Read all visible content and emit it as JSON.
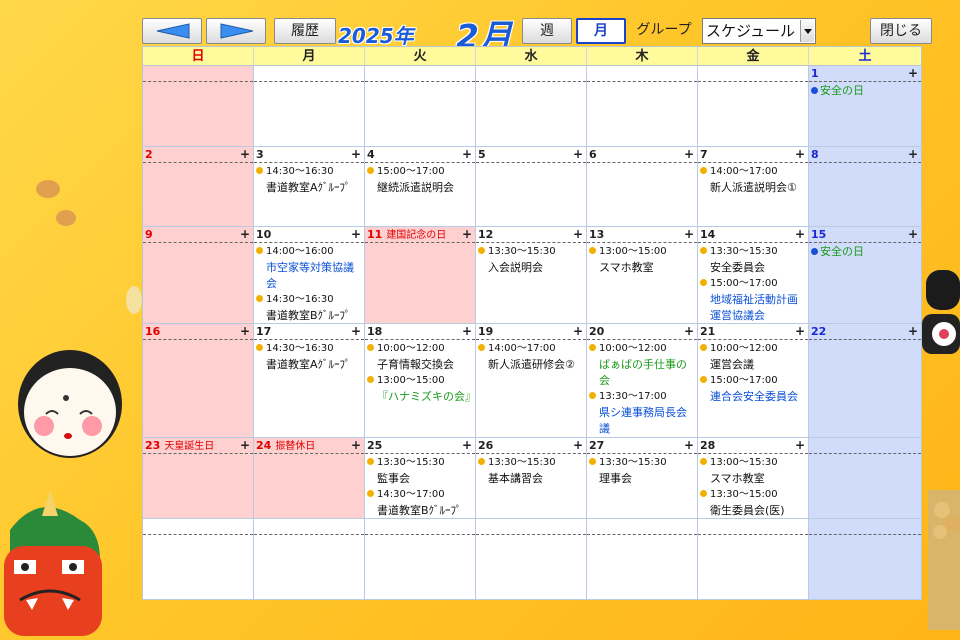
{
  "toolbar": {
    "prev_icon": "left-triangle-arrow",
    "next_icon": "right-triangle-arrow",
    "history_label": "履歴",
    "year": "2025年",
    "month": "2月",
    "week_label": "週",
    "month_label": "月",
    "group_label": "グループ",
    "view_select_value": "スケジュール",
    "close_label": "閉じる"
  },
  "colors": {
    "sunday_text": "#e00000",
    "saturday_text": "#1a2ad0",
    "sunday_bg": "#ffd0d0",
    "saturday_bg": "#d1dcfb",
    "weekday_header_bg": "#fffa9c",
    "event_dot": "#f2b000",
    "note_dot": "#1a4ed6",
    "link_blue": "#0a4fd6",
    "link_green": "#1a9a1a"
  },
  "weekdays": [
    "日",
    "月",
    "火",
    "水",
    "木",
    "金",
    "土"
  ],
  "weeks": [
    [
      {
        "day": "",
        "type": "sun",
        "plus": false,
        "events": []
      },
      {
        "day": "",
        "type": "",
        "plus": false,
        "events": []
      },
      {
        "day": "",
        "type": "",
        "plus": false,
        "events": []
      },
      {
        "day": "",
        "type": "",
        "plus": false,
        "events": []
      },
      {
        "day": "",
        "type": "",
        "plus": false,
        "events": []
      },
      {
        "day": "",
        "type": "",
        "plus": false,
        "events": []
      },
      {
        "day": "1",
        "type": "sat",
        "plus": true,
        "notes": [
          "安全の日"
        ],
        "events": []
      }
    ],
    [
      {
        "day": "2",
        "type": "sun",
        "plus": true,
        "events": []
      },
      {
        "day": "3",
        "type": "",
        "plus": true,
        "events": [
          {
            "time": "14:30～16:30",
            "title": "書道教室Aｸﾞﾙｰﾌﾟ",
            "color": ""
          }
        ]
      },
      {
        "day": "4",
        "type": "",
        "plus": true,
        "events": [
          {
            "time": "15:00～17:00",
            "title": "継続派遣説明会",
            "color": ""
          }
        ]
      },
      {
        "day": "5",
        "type": "",
        "plus": true,
        "events": []
      },
      {
        "day": "6",
        "type": "",
        "plus": true,
        "events": []
      },
      {
        "day": "7",
        "type": "",
        "plus": true,
        "events": [
          {
            "time": "14:00～17:00",
            "title": "新人派遣説明会①",
            "color": ""
          }
        ]
      },
      {
        "day": "8",
        "type": "sat",
        "plus": true,
        "events": []
      }
    ],
    [
      {
        "day": "9",
        "type": "sun",
        "plus": true,
        "events": []
      },
      {
        "day": "10",
        "type": "",
        "plus": true,
        "events": [
          {
            "time": "14:00～16:00",
            "title": "市空家等対策協議会",
            "color": "blue"
          },
          {
            "time": "14:30～16:30",
            "title": "書道教室Bｸﾞﾙｰﾌﾟ",
            "color": ""
          }
        ]
      },
      {
        "day": "11",
        "type": "hol",
        "holiday": "建国記念の日",
        "plus": true,
        "events": []
      },
      {
        "day": "12",
        "type": "",
        "plus": true,
        "events": [
          {
            "time": "13:30～15:30",
            "title": "入会説明会",
            "color": ""
          }
        ]
      },
      {
        "day": "13",
        "type": "",
        "plus": true,
        "events": [
          {
            "time": "13:00～15:00",
            "title": "スマホ教室",
            "color": ""
          }
        ]
      },
      {
        "day": "14",
        "type": "",
        "plus": true,
        "events": [
          {
            "time": "13:30～15:30",
            "title": "安全委員会",
            "color": ""
          },
          {
            "time": "15:00～17:00",
            "title": "地域福祉活動計画運営協議会",
            "color": "blue"
          }
        ]
      },
      {
        "day": "15",
        "type": "sat",
        "plus": true,
        "notes": [
          "安全の日"
        ],
        "events": []
      }
    ],
    [
      {
        "day": "16",
        "type": "sun",
        "plus": true,
        "events": []
      },
      {
        "day": "17",
        "type": "",
        "plus": true,
        "events": [
          {
            "time": "14:30～16:30",
            "title": "書道教室Aｸﾞﾙｰﾌﾟ",
            "color": ""
          }
        ]
      },
      {
        "day": "18",
        "type": "",
        "plus": true,
        "events": [
          {
            "time": "10:00～12:00",
            "title": "子育情報交換会",
            "color": ""
          },
          {
            "time": "13:00～15:00",
            "title": "『ハナミズキの会』",
            "color": "green"
          }
        ]
      },
      {
        "day": "19",
        "type": "",
        "plus": true,
        "events": [
          {
            "time": "14:00～17:00",
            "title": "新人派遣研修会②",
            "color": ""
          }
        ]
      },
      {
        "day": "20",
        "type": "",
        "plus": true,
        "events": [
          {
            "time": "10:00～12:00",
            "title": "ばぁばの手仕事の会",
            "color": "green"
          },
          {
            "time": "13:30～17:00",
            "title": "県シ連事務局長会議",
            "color": "blue"
          }
        ]
      },
      {
        "day": "21",
        "type": "",
        "plus": true,
        "events": [
          {
            "time": "10:00～12:00",
            "title": "運営会議",
            "color": ""
          },
          {
            "time": "15:00～17:00",
            "title": "連合会安全委員会",
            "color": "blue"
          }
        ]
      },
      {
        "day": "22",
        "type": "sat",
        "plus": true,
        "events": []
      }
    ],
    [
      {
        "day": "23",
        "type": "sun",
        "holiday": "天皇誕生日",
        "plus": true,
        "events": []
      },
      {
        "day": "24",
        "type": "hol",
        "holiday": "振替休日",
        "plus": true,
        "events": []
      },
      {
        "day": "25",
        "type": "",
        "plus": true,
        "events": [
          {
            "time": "13:30～15:30",
            "title": "監事会",
            "color": ""
          },
          {
            "time": "14:30～17:00",
            "title": "書道教室Bｸﾞﾙｰﾌﾟ",
            "color": ""
          }
        ]
      },
      {
        "day": "26",
        "type": "",
        "plus": true,
        "events": [
          {
            "time": "13:30～15:30",
            "title": "基本講習会",
            "color": ""
          }
        ]
      },
      {
        "day": "27",
        "type": "",
        "plus": true,
        "events": [
          {
            "time": "13:30～15:30",
            "title": "理事会",
            "color": ""
          }
        ]
      },
      {
        "day": "28",
        "type": "",
        "plus": true,
        "events": [
          {
            "time": "13:00～15:30",
            "title": "スマホ教室",
            "color": ""
          },
          {
            "time": "13:30～15:00",
            "title": "衛生委員会(医)",
            "color": ""
          }
        ]
      },
      {
        "day": "",
        "type": "sat",
        "plus": false,
        "events": []
      }
    ],
    [
      {
        "day": "",
        "type": "",
        "plus": false,
        "events": []
      },
      {
        "day": "",
        "type": "",
        "plus": false,
        "events": []
      },
      {
        "day": "",
        "type": "",
        "plus": false,
        "events": []
      },
      {
        "day": "",
        "type": "",
        "plus": false,
        "events": []
      },
      {
        "day": "",
        "type": "",
        "plus": false,
        "events": []
      },
      {
        "day": "",
        "type": "",
        "plus": false,
        "events": []
      },
      {
        "day": "",
        "type": "sat",
        "plus": false,
        "events": []
      }
    ]
  ]
}
